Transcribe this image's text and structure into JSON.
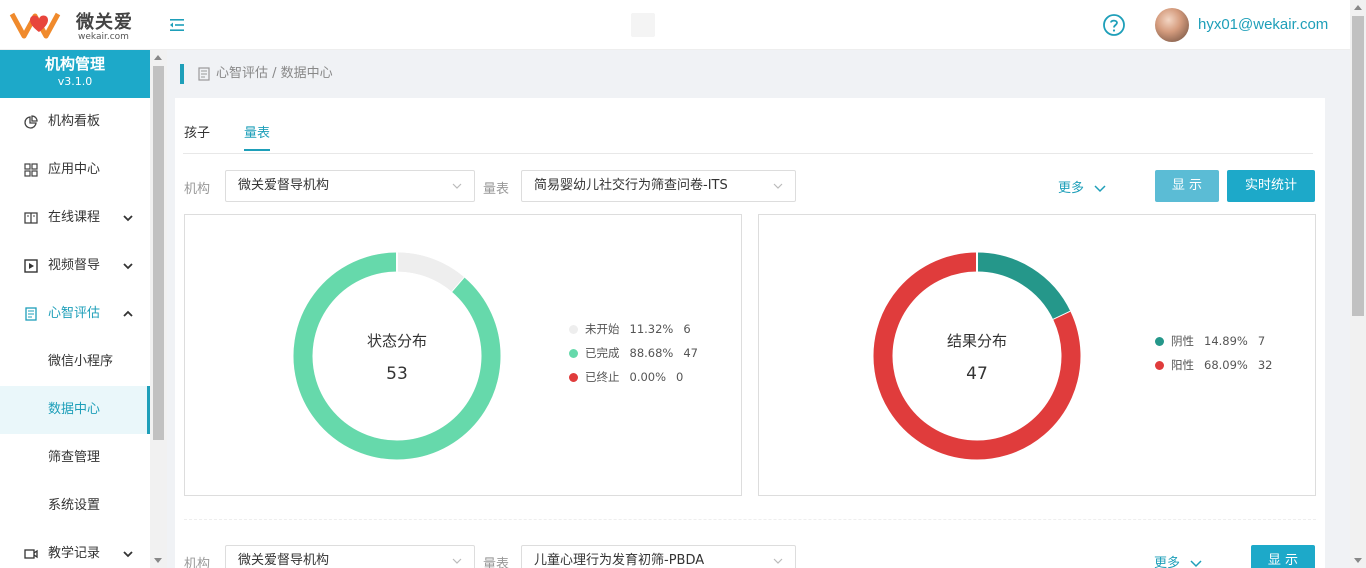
{
  "brand": {
    "name": "微关爱",
    "domain": "wekair.com",
    "accent": "#1da9c9"
  },
  "header": {
    "user_email": "hyx01@wekair.com",
    "help_icon": "question-circle-icon",
    "menu_icon": "menu-fold-icon"
  },
  "sidebar": {
    "title": "机构管理",
    "version": "v3.1.0",
    "items": [
      {
        "label": "机构看板",
        "icon": "pie-chart-icon"
      },
      {
        "label": "应用中心",
        "icon": "appstore-icon"
      },
      {
        "label": "在线课程",
        "icon": "book-icon"
      },
      {
        "label": "视频督导",
        "icon": "play-square-icon"
      },
      {
        "label": "心智评估",
        "icon": "file-icon"
      },
      {
        "label": "微信小程序"
      },
      {
        "label": "数据中心"
      },
      {
        "label": "筛查管理"
      },
      {
        "label": "系统设置"
      },
      {
        "label": "教学记录",
        "icon": "video-camera-icon"
      }
    ]
  },
  "breadcrumb": "心智评估 / 数据中心",
  "tabs": [
    "孩子",
    "量表"
  ],
  "filters": [
    {
      "org_label": "机构",
      "org_value": "微关爱督导机构",
      "scale_label": "量表",
      "scale_value": "简易婴幼儿社交行为筛查问卷-ITS",
      "more": "更多",
      "show": "显 示",
      "stat": "实时统计"
    },
    {
      "org_label": "机构",
      "org_value": "微关爱督导机构",
      "scale_label": "量表",
      "scale_value": "儿童心理行为发育初筛-PBDA",
      "more": "更多",
      "show": "显 示"
    }
  ],
  "chart_data": [
    {
      "type": "pie",
      "title": "状态分布",
      "total": "53",
      "series": [
        {
          "name": "未开始",
          "percent": "11.32%",
          "count": "6",
          "value": 11.32,
          "color": "#eeeeee"
        },
        {
          "name": "已完成",
          "percent": "88.68%",
          "count": "47",
          "value": 88.68,
          "color": "#66d9ab"
        },
        {
          "name": "已终止",
          "percent": "0.00%",
          "count": "0",
          "value": 0,
          "color": "#e03c3c"
        }
      ]
    },
    {
      "type": "pie",
      "title": "结果分布",
      "total": "47",
      "series": [
        {
          "name": "阴性",
          "percent": "14.89%",
          "count": "7",
          "value": 7,
          "color": "#25978a"
        },
        {
          "name": "阳性",
          "percent": "68.09%",
          "count": "32",
          "value": 32,
          "color": "#e03c3c"
        }
      ]
    }
  ]
}
